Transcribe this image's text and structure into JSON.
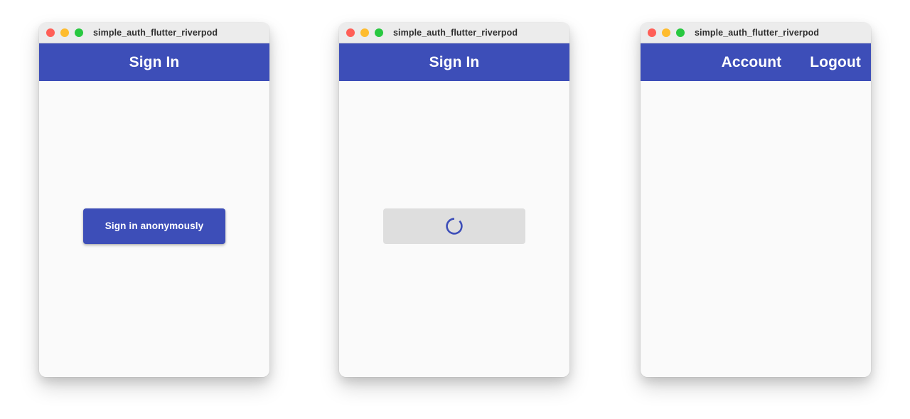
{
  "theme": {
    "primary": "#3d4eb8",
    "page_background": "#ffffff",
    "window_background": "#fafafa",
    "titlebar_background": "#ececec",
    "disabled_button": "#dedede",
    "traffic_red": "#ff5f57",
    "traffic_yellow": "#febc2e",
    "traffic_green": "#28c840",
    "on_primary": "#ffffff"
  },
  "windows": [
    {
      "title": "simple_auth_flutter_riverpod",
      "traffic_lights": {
        "close": "close-window-icon",
        "minimize": "minimize-window-icon",
        "maximize": "maximize-window-icon"
      },
      "appbar": {
        "title": "Sign In",
        "alignment": "center",
        "actions": []
      },
      "content": {
        "kind": "button",
        "button_label": "Sign in anonymously",
        "button_state": "enabled"
      }
    },
    {
      "title": "simple_auth_flutter_riverpod",
      "traffic_lights": {
        "close": "close-window-icon",
        "minimize": "minimize-window-icon",
        "maximize": "maximize-window-icon"
      },
      "appbar": {
        "title": "Sign In",
        "alignment": "center",
        "actions": []
      },
      "content": {
        "kind": "loading-button",
        "button_label": "",
        "button_state": "disabled",
        "spinner": "loading-spinner-icon"
      }
    },
    {
      "title": "simple_auth_flutter_riverpod",
      "traffic_lights": {
        "close": "close-window-icon",
        "minimize": "minimize-window-icon",
        "maximize": "maximize-window-icon"
      },
      "appbar": {
        "title": "Account",
        "alignment": "end",
        "actions": [
          {
            "label": "Logout"
          }
        ]
      },
      "content": {
        "kind": "empty",
        "button_label": "",
        "button_state": ""
      }
    }
  ]
}
